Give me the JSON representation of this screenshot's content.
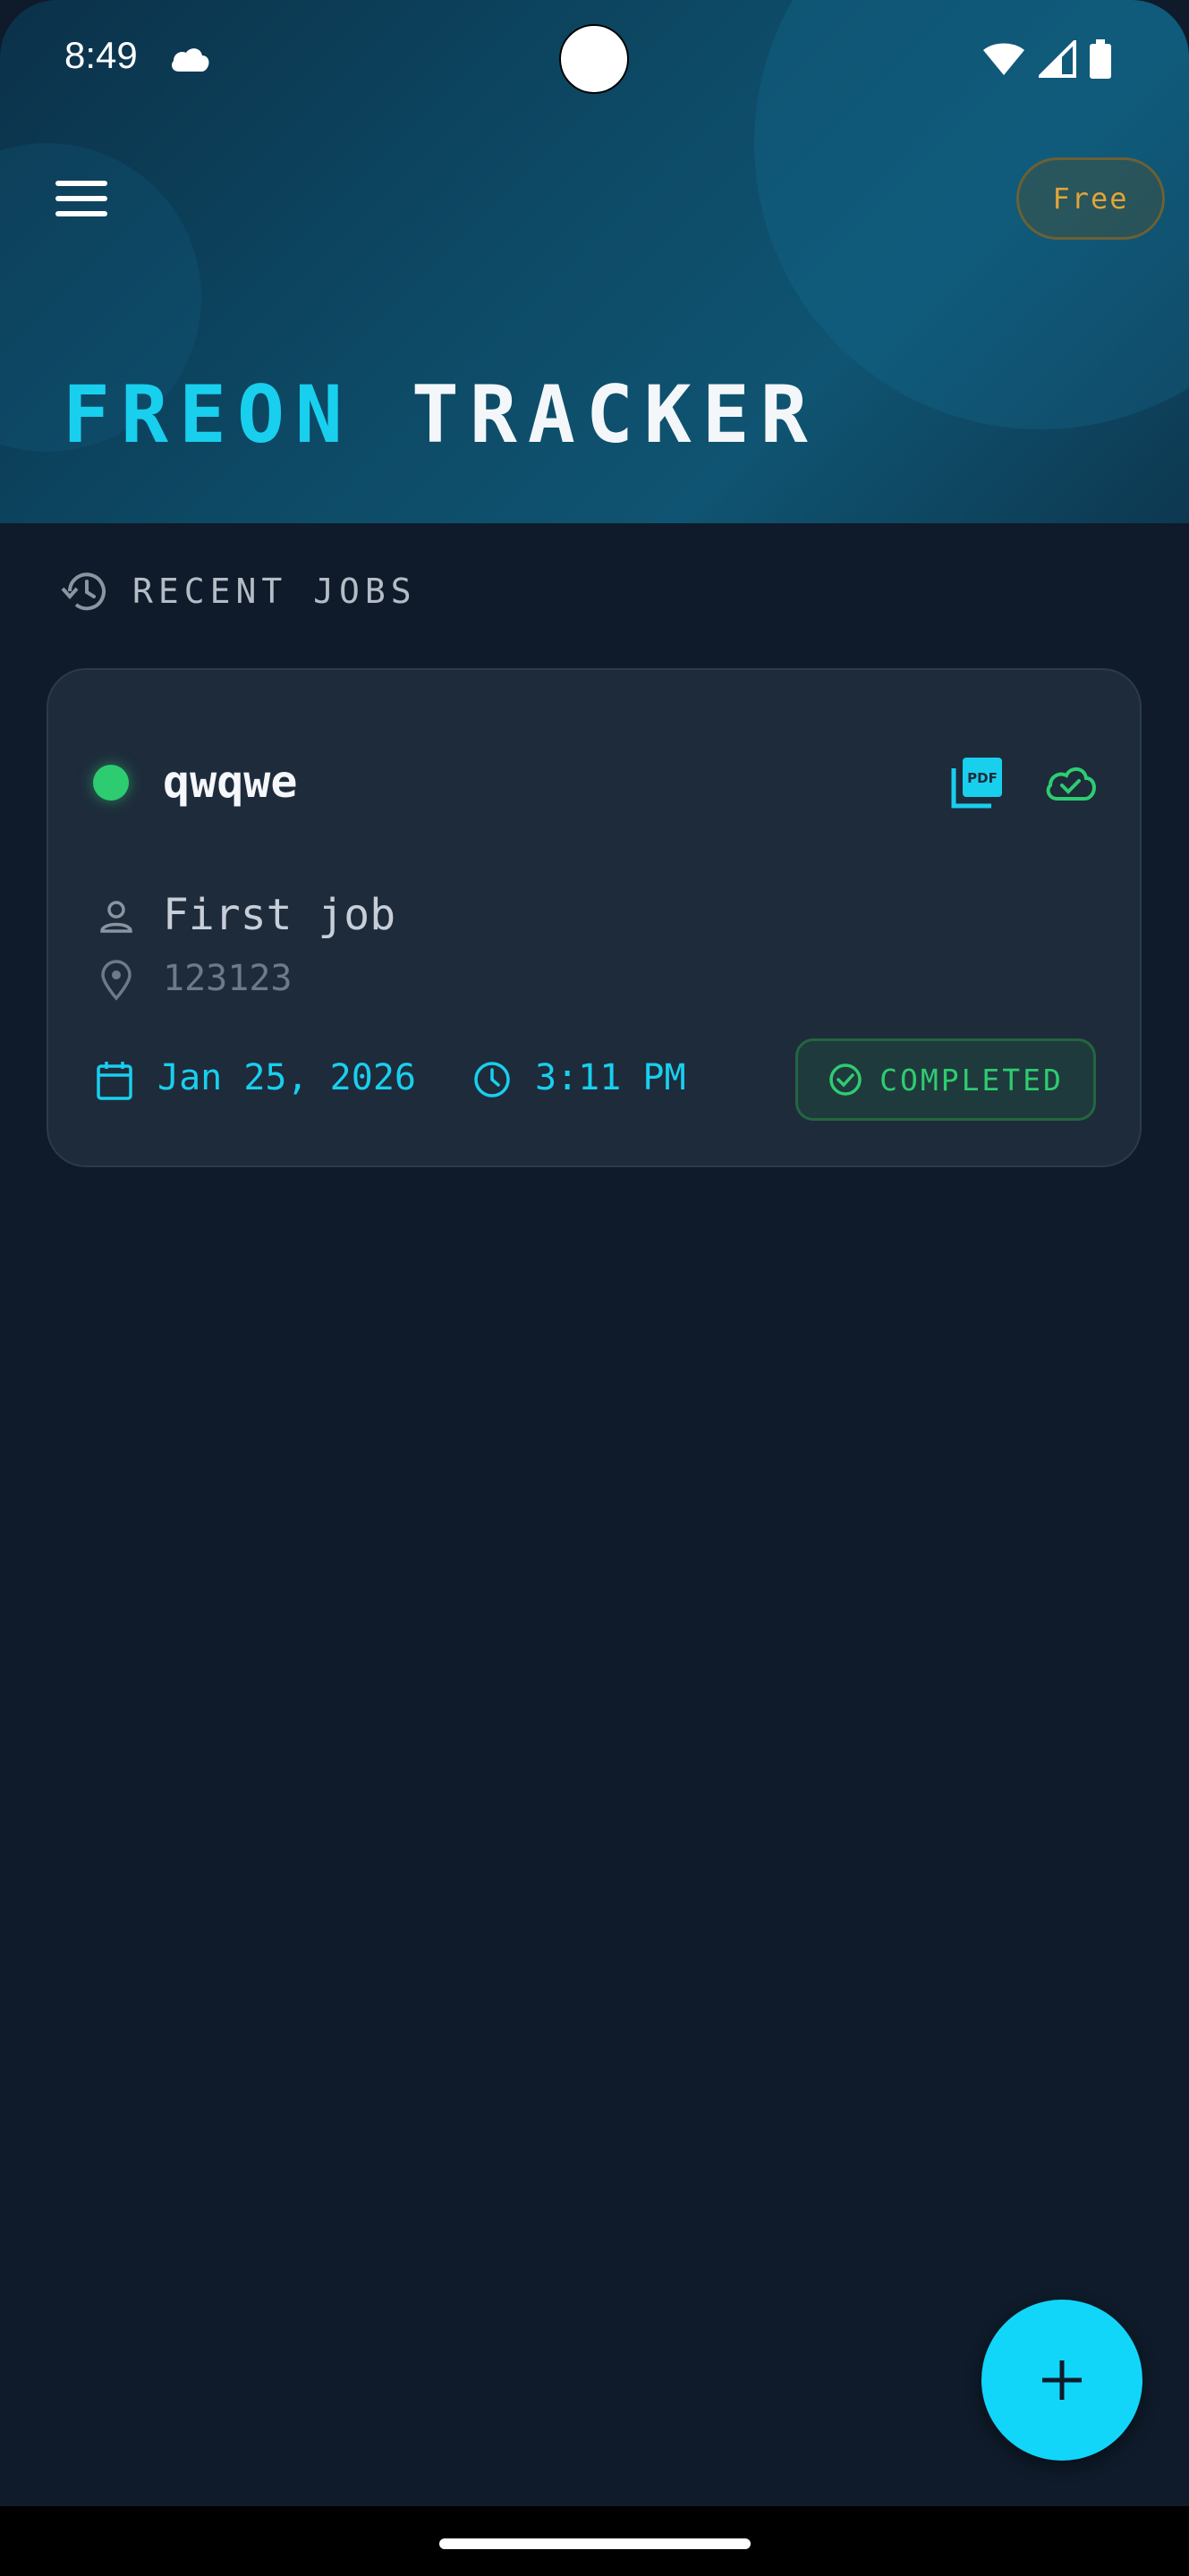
{
  "status_bar": {
    "time": "8:49"
  },
  "header": {
    "plan_badge": "Free",
    "title_accent": "FREON",
    "title_main": "TRACKER"
  },
  "section": {
    "title": "RECENT JOBS"
  },
  "jobs": [
    {
      "title": "qwqwe",
      "client": "First job",
      "location": "123123",
      "date": "Jan 25, 2026",
      "time": "3:11 PM",
      "status": "COMPLETED"
    }
  ],
  "icons": {
    "menu": "menu-icon",
    "history": "history-icon",
    "pdf": "pdf-icon",
    "sync": "cloud-done-icon",
    "person": "person-icon",
    "location": "location-pin-icon",
    "calendar": "calendar-icon",
    "clock": "clock-icon",
    "check": "check-circle-icon",
    "add": "add-icon"
  },
  "colors": {
    "accent": "#19cfee",
    "success": "#2ecc71",
    "plan_badge": "#e1a437",
    "background": "#0f1b2a",
    "card": "#1e2b3b"
  }
}
